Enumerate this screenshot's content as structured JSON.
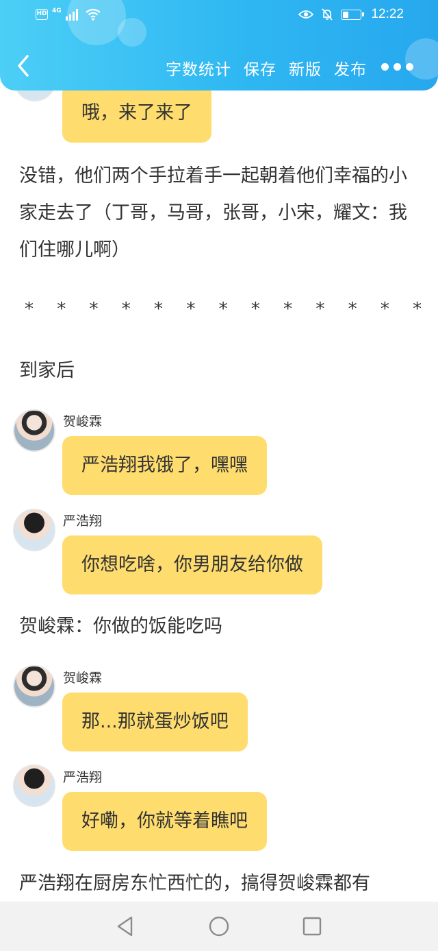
{
  "status_bar": {
    "hd": "HD",
    "network": "4G",
    "time": "12:22",
    "battery_level": 0.35
  },
  "toolbar": {
    "back_icon": "chevron-left-icon",
    "word_count": "字数统计",
    "save": "保存",
    "new_version": "新版",
    "publish": "发布",
    "more_icon": "more-dots-icon"
  },
  "colors": {
    "header_blue": "#2fb7f2",
    "bubble_yellow": "#fedc6e"
  },
  "story": {
    "bubble_top": "哦，来了来了",
    "paragraph_1": "没错，他们两个手拉着手一起朝着他们幸福的小家走去了（丁哥，马哥，张哥，小宋，耀文：我们住哪儿啊）",
    "separator": "* * * * * * * * * * * * * * * * * * * *",
    "paragraph_2": "到家后",
    "messages": [
      {
        "name": "贺峻霖",
        "text": "严浩翔我饿了，嘿嘿"
      },
      {
        "name": "严浩翔",
        "text": "你想吃啥，你男朋友给你做"
      },
      {
        "name": "贺峻霖",
        "text": "那...那就蛋炒饭吧"
      },
      {
        "name": "严浩翔",
        "text": "好嘞，你就等着瞧吧"
      }
    ],
    "paragraph_3": "贺峻霖：你做的饭能吃吗",
    "paragraph_4": "严浩翔在厨房东忙西忙的，搞得贺峻霖都有"
  },
  "bottom_nav": {
    "back": "triangle-back-icon",
    "home": "circle-home-icon",
    "recents": "square-recents-icon"
  }
}
